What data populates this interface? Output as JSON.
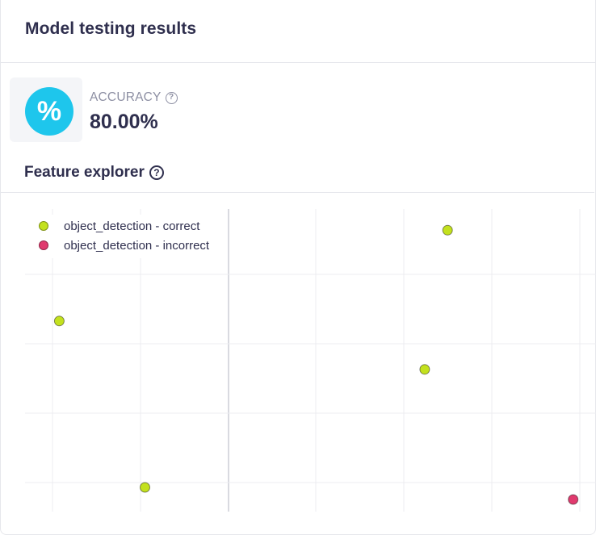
{
  "card": {
    "title": "Model testing results"
  },
  "metric": {
    "icon": "percent-icon",
    "icon_glyph": "%",
    "label": "ACCURACY",
    "value": "80.00%",
    "icon_color": "#1ec6ec"
  },
  "feature_explorer": {
    "title": "Feature explorer"
  },
  "chart_data": {
    "type": "scatter",
    "grid": true,
    "legend_placement": "top-left",
    "xlim": [
      0,
      1
    ],
    "ylim": [
      0,
      1
    ],
    "series": [
      {
        "name": "object_detection - correct",
        "color": "#c3e11e",
        "points": [
          {
            "x": 0.06,
            "y": 0.63
          },
          {
            "x": 0.21,
            "y": 0.08
          },
          {
            "x": 0.7,
            "y": 0.47
          },
          {
            "x": 0.74,
            "y": 0.93
          }
        ]
      },
      {
        "name": "object_detection - incorrect",
        "color": "#e03a6e",
        "points": [
          {
            "x": 0.96,
            "y": 0.04
          }
        ]
      }
    ]
  }
}
